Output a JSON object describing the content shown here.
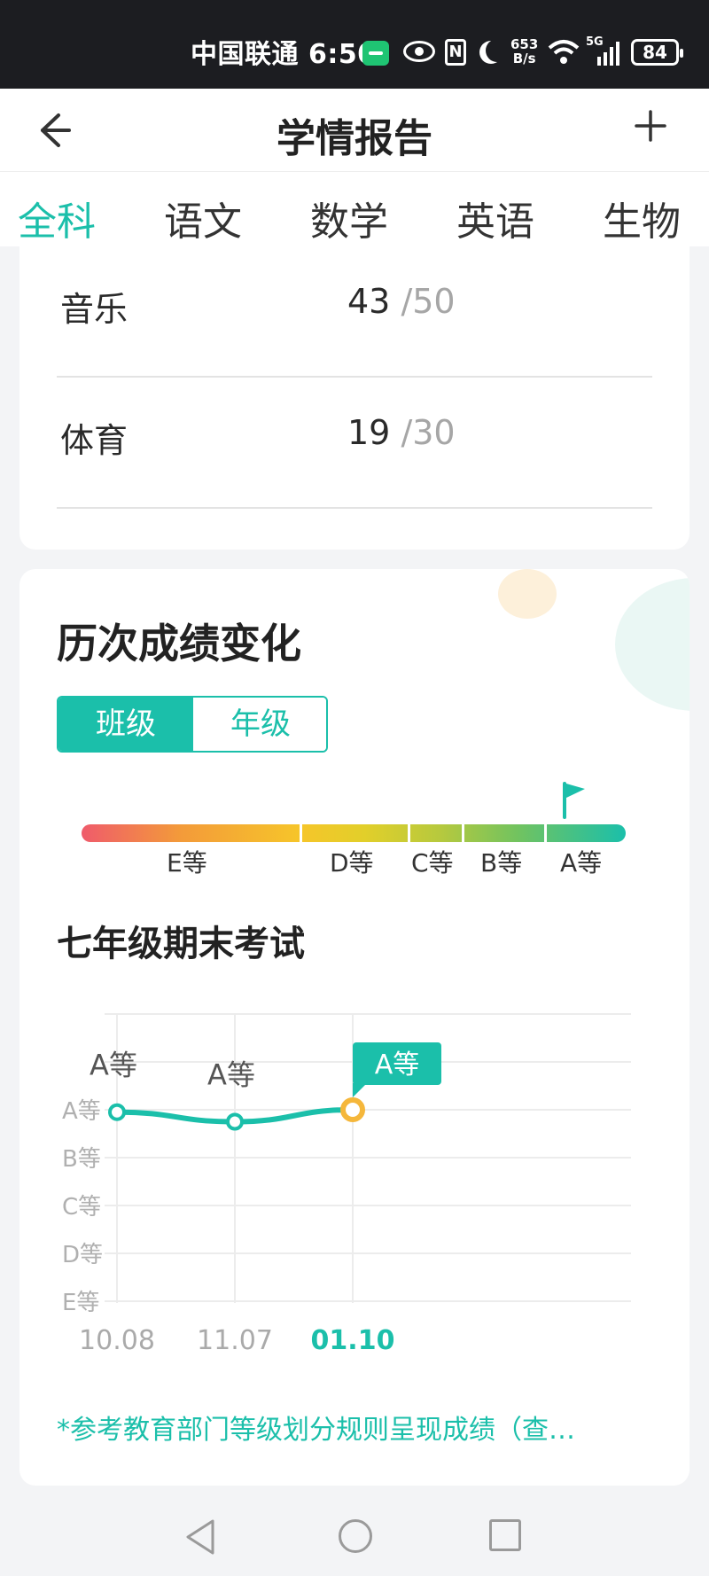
{
  "status_bar": {
    "carrier_time": "中国联通 6:50",
    "net_speed_value": "653",
    "net_speed_unit": "B/s",
    "signal_label": "5G",
    "battery": "84",
    "nfc": "N"
  },
  "header": {
    "title": "学情报告"
  },
  "tabs": [
    {
      "label": "全科",
      "active": true
    },
    {
      "label": "语文",
      "active": false
    },
    {
      "label": "数学",
      "active": false
    },
    {
      "label": "英语",
      "active": false
    },
    {
      "label": "生物",
      "active": false
    }
  ],
  "scores": [
    {
      "subject": "音乐",
      "score": "43",
      "max": "/50"
    },
    {
      "subject": "体育",
      "score": "19",
      "max": "/30"
    }
  ],
  "trend": {
    "title": "历次成绩变化",
    "toggle": {
      "class_label": "班级",
      "grade_label": "年级"
    },
    "grade_scale": [
      "E等",
      "D等",
      "C等",
      "B等",
      "A等"
    ],
    "current_grade": "A等",
    "exam_title": "七年级期末考试",
    "note": "*参考教育部门等级划分规则呈现成绩（查…"
  },
  "colors": {
    "accent": "#1bbfaa",
    "highlight_point": "#f5b73b",
    "grade_bar_start": "#ef5b6b",
    "grade_bar_end": "#1bbfaa"
  },
  "icons": {
    "back": "arrow-left-icon",
    "add": "plus-icon",
    "flag": "flag-icon"
  },
  "chart_data": {
    "type": "line",
    "categories": [
      "10.08",
      "11.07",
      "01.10"
    ],
    "y_categories": [
      "A等",
      "B等",
      "C等",
      "D等",
      "E等"
    ],
    "series": [
      {
        "values": [
          4.95,
          4.75,
          5.0
        ],
        "point_labels": [
          "A等",
          "A等",
          "A等"
        ]
      }
    ],
    "highlight_index": 2,
    "grid": true
  }
}
